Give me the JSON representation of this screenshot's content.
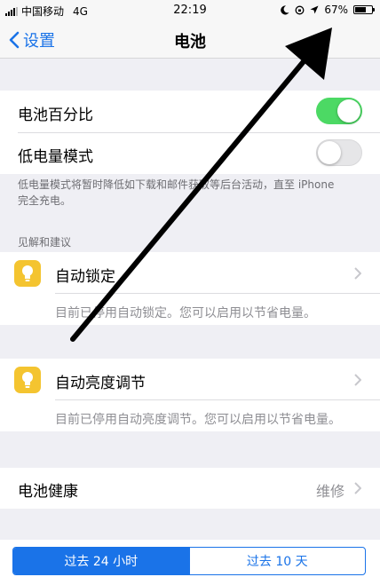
{
  "status_bar": {
    "carrier": "中国移动",
    "network": "4G",
    "time": "22:19",
    "battery": "67%",
    "battery_level": 0.67
  },
  "nav": {
    "back_label": "设置",
    "title": "电池"
  },
  "settings": {
    "battery_percentage_label": "电池百分比",
    "battery_percentage_on": true,
    "low_power_label": "低电量模式",
    "low_power_on": false,
    "low_power_note_line1": "低电量模式将暂时降低如下载和邮件获取等后台活动，直至 iPhone",
    "low_power_note_line2": "完全充电。"
  },
  "insights": {
    "header": "见解和建议",
    "items": [
      {
        "title": "自动锁定",
        "subtitle": "目前已停用自动锁定。您可以启用以节省电量。",
        "icon": "lightbulb-icon"
      },
      {
        "title": "自动亮度调节",
        "subtitle": "目前已停用自动亮度调节。您可以启用以节省电量。",
        "icon": "lightbulb-icon"
      }
    ]
  },
  "health": {
    "label": "电池健康",
    "value": "维修"
  },
  "segments": {
    "last_24h": "过去 24 小时",
    "last_10d": "过去 10 天"
  },
  "colors": {
    "accent": "#1a73e8",
    "toggle_on": "#4cd964",
    "icon_bg": "#f4c430"
  }
}
